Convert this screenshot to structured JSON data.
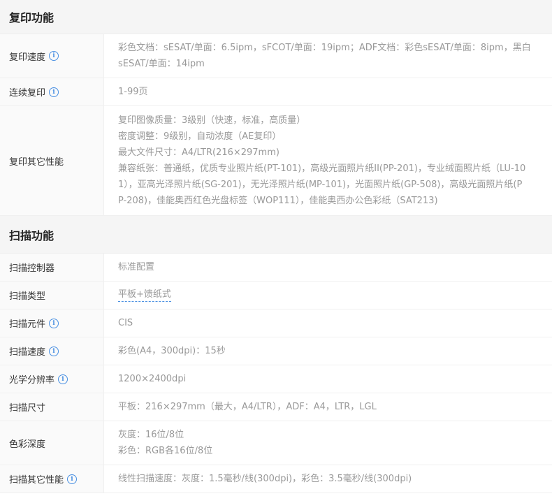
{
  "copy_section": {
    "title": "复印功能",
    "speed": {
      "label": "复印速度",
      "lines": [
        "彩色文档：sESAT/单面：6.5ipm，sFCOT/单面：19ipm；ADF文档：彩色sESAT/单面：8ipm，黑白",
        "sESAT/单面：14ipm"
      ]
    },
    "continuous": {
      "label": "连续复印",
      "value": "1-99页"
    },
    "other": {
      "label": "复印其它性能",
      "lines": [
        "复印图像质量：3级别（快速，标准，高质量）",
        "密度调整：9级别，自动浓度（AE复印）",
        "最大文件尺寸：A4/LTR(216×297mm)",
        "兼容纸张：普通纸，优质专业照片纸(PT-101)，高级光面照片纸II(PP-201)，专业绒面照片纸（LU-10",
        "1），亚高光泽照片纸(SG-201)，无光泽照片纸(MP-101)，光面照片纸(GP-508)，高级光面照片纸(P",
        "P-208)，佳能奥西红色光盘标签（WOP111），佳能奥西办公色彩纸（SAT213)"
      ]
    }
  },
  "scan_section": {
    "title": "扫描功能",
    "controller": {
      "label": "扫描控制器",
      "value": "标准配置"
    },
    "type": {
      "label": "扫描类型",
      "value": "平板+馈纸式"
    },
    "element": {
      "label": "扫描元件",
      "value": "CIS"
    },
    "speed": {
      "label": "扫描速度",
      "value": "彩色(A4，300dpi)：15秒"
    },
    "resolution": {
      "label": "光学分辨率",
      "value": "1200×2400dpi"
    },
    "size": {
      "label": "扫描尺寸",
      "value": "平板：216×297mm（最大，A4/LTR），ADF：A4，LTR，LGL"
    },
    "depth": {
      "label": "色彩深度",
      "lines": [
        "灰度：16位/8位",
        "彩色：RGB各16位/8位"
      ]
    },
    "other": {
      "label": "扫描其它性能",
      "value": "线性扫描速度：灰度：1.5毫秒/线(300dpi)，彩色：3.5毫秒/线(300dpi)"
    }
  },
  "icons": {
    "info": "info-icon",
    "info_glyph": "i"
  }
}
